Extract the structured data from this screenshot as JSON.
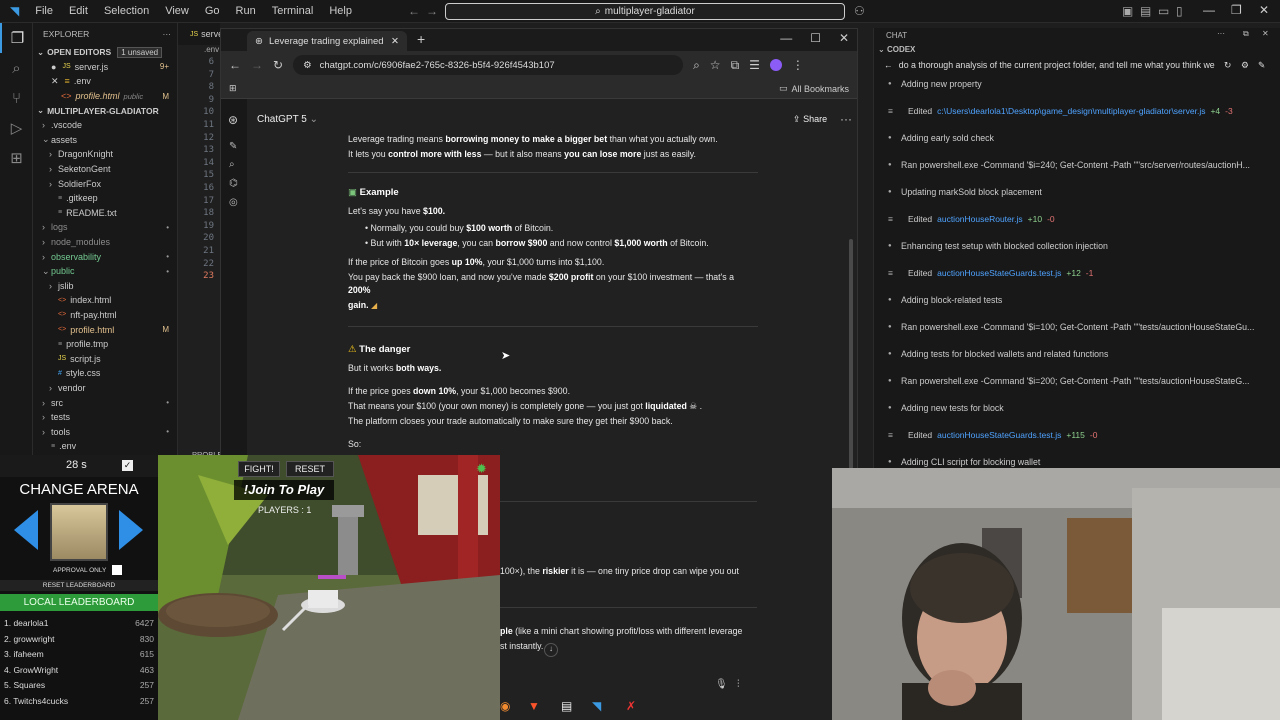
{
  "vscode": {
    "menu": [
      "File",
      "Edit",
      "Selection",
      "View",
      "Go",
      "Run",
      "Terminal",
      "Help"
    ],
    "command_center": "multiplayer-gladiator",
    "explorer_title": "EXPLORER",
    "open_editors_title": "OPEN EDITORS",
    "unsaved_badge": "1 unsaved",
    "open_editors": [
      {
        "name": "server.js",
        "badge": "9+"
      },
      {
        "name": ".env",
        "badge": ""
      },
      {
        "name": "profile.html",
        "desc": "public",
        "badge": "M"
      }
    ],
    "project_title": "MULTIPLAYER-GLADIATOR",
    "tree": [
      {
        "name": ".vscode",
        "indent": 1,
        "type": "folder"
      },
      {
        "name": "assets",
        "indent": 1,
        "type": "folder-open"
      },
      {
        "name": "DragonKnight",
        "indent": 2,
        "type": "folder"
      },
      {
        "name": "SeketonGent",
        "indent": 2,
        "type": "folder"
      },
      {
        "name": "SoldierFox",
        "indent": 2,
        "type": "folder"
      },
      {
        "name": ".gitkeep",
        "indent": 2,
        "type": "file"
      },
      {
        "name": "README.txt",
        "indent": 2,
        "type": "file"
      },
      {
        "name": "logs",
        "indent": 1,
        "type": "folder",
        "mark": "•"
      },
      {
        "name": "node_modules",
        "indent": 1,
        "type": "folder"
      },
      {
        "name": "observability",
        "indent": 1,
        "type": "folder",
        "mark": "•"
      },
      {
        "name": "public",
        "indent": 1,
        "type": "folder-open",
        "mark": "•"
      },
      {
        "name": "jslib",
        "indent": 2,
        "type": "folder"
      },
      {
        "name": "index.html",
        "indent": 2,
        "type": "file"
      },
      {
        "name": "nft-pay.html",
        "indent": 2,
        "type": "file"
      },
      {
        "name": "profile.html",
        "indent": 2,
        "type": "file",
        "mark": "M"
      },
      {
        "name": "profile.tmp",
        "indent": 2,
        "type": "file"
      },
      {
        "name": "script.js",
        "indent": 2,
        "type": "file"
      },
      {
        "name": "style.css",
        "indent": 2,
        "type": "file"
      },
      {
        "name": "vendor",
        "indent": 2,
        "type": "folder"
      },
      {
        "name": "src",
        "indent": 1,
        "type": "folder",
        "mark": "•"
      },
      {
        "name": "tests",
        "indent": 1,
        "type": "folder"
      },
      {
        "name": "tools",
        "indent": 1,
        "type": "folder",
        "mark": "•"
      },
      {
        "name": ".env",
        "indent": 1,
        "type": "file"
      }
    ],
    "line_numbers": [
      "6",
      "7",
      "8",
      "9",
      "10",
      "11",
      "12",
      "13",
      "14",
      "15",
      "16",
      "17",
      "18",
      "19",
      "20",
      "21",
      "22",
      "23"
    ],
    "editor_tab_fragment": "serve",
    "editor_tab_fragment2": ".env",
    "problems_fragment": "PROBLE"
  },
  "browser": {
    "tab_title": "Leverage trading explained",
    "url": "chatgpt.com/c/6906fae2-765c-8326-b5f4-926f4543b107",
    "bookmarks_label": "All Bookmarks",
    "model_label": "ChatGPT 5",
    "share_label": "Share"
  },
  "chat": {
    "intro_line1_a": "Leverage trading means ",
    "intro_line1_b": "borrowing money to make a bigger bet",
    "intro_line1_c": " than what you actually own.",
    "intro_line2_a": "It lets you ",
    "intro_line2_b": "control more with less",
    "intro_line2_c": " — but it also means ",
    "intro_line2_d": "you can lose more",
    "intro_line2_e": " just as easily.",
    "example_heading": "Example",
    "example_intro_a": "Let's say you have ",
    "example_intro_b": "$100.",
    "bullet1_a": "Normally, you could buy ",
    "bullet1_b": "$100 worth",
    "bullet1_c": " of Bitcoin.",
    "bullet2_a": "But with ",
    "bullet2_b": "10× leverage",
    "bullet2_c": ", you can ",
    "bullet2_d": "borrow $900",
    "bullet2_e": " and now control ",
    "bullet2_f": "$1,000 worth",
    "bullet2_g": " of Bitcoin.",
    "up_a": "If the price of Bitcoin goes ",
    "up_b": "up 10%",
    "up_c": ", your $1,000 turns into $1,100.",
    "payback_a": "You pay back the $900 loan, and now you've made ",
    "payback_b": "$200 profit",
    "payback_c": " on your $100 investment — that's a ",
    "payback_d": "200%",
    "payback_e": "gain.",
    "danger_heading": "The danger",
    "both_a": "But it works ",
    "both_b": "both ways.",
    "down_a": "If the price goes ",
    "down_b": "down 10%",
    "down_c": ", your $1,000 becomes $900.",
    "gone_a": "That means your $100 (your own money) is completely gone — you just got ",
    "gone_b": "liquidated",
    "closes": "The platform closes your trade automatically to make sure they get their $900 back.",
    "so": "So:",
    "riskier_a": "100×), the ",
    "riskier_b": "riskier",
    "riskier_c": " it is — one tiny price drop can wipe you out",
    "mini_a": "ple",
    "mini_b": " (like a mini chart showing profit/loss with different leverage",
    "instantly": "st instantly."
  },
  "codex": {
    "chat_label": "CHAT",
    "codex_label": "CODEX",
    "prompt": "do a thorough analysis of the current project folder, and tell me what you think we",
    "items": [
      {
        "kind": "item",
        "text": "Adding new property"
      },
      {
        "kind": "edit",
        "label": "Edited",
        "file": "c:\\Users\\dearlola1\\Desktop\\game_design\\multiplayer-gladiator\\server.js",
        "plus": "+4",
        "minus": "-3"
      },
      {
        "kind": "item",
        "text": "Adding early sold check"
      },
      {
        "kind": "item",
        "text": "Ran powershell.exe -Command '$i=240; Get-Content -Path \"\"src/server/routes/auctionH..."
      },
      {
        "kind": "item",
        "text": "Updating markSold block placement"
      },
      {
        "kind": "edit",
        "label": "Edited",
        "file": "auctionHouseRouter.js",
        "plus": "+10",
        "minus": "-0"
      },
      {
        "kind": "item",
        "text": "Enhancing test setup with blocked collection injection"
      },
      {
        "kind": "edit",
        "label": "Edited",
        "file": "auctionHouseStateGuards.test.js",
        "plus": "+12",
        "minus": "-1"
      },
      {
        "kind": "item",
        "text": "Adding block-related tests"
      },
      {
        "kind": "item",
        "text": "Ran powershell.exe -Command '$i=100; Get-Content -Path \"\"tests/auctionHouseStateGu..."
      },
      {
        "kind": "item",
        "text": "Adding tests for blocked wallets and related functions"
      },
      {
        "kind": "item",
        "text": "Ran powershell.exe -Command '$i=200; Get-Content -Path \"\"tests/auctionHouseStateG..."
      },
      {
        "kind": "item",
        "text": "Adding new tests for block"
      },
      {
        "kind": "edit",
        "label": "Edited",
        "file": "auctionHouseStateGuards.test.js",
        "plus": "+115",
        "minus": "-0"
      },
      {
        "kind": "item",
        "text": "Adding CLI script for blocking wallet"
      }
    ]
  },
  "game": {
    "timer": "28 s",
    "change_arena": "CHANGE ARENA",
    "approval_only": "APPROVAL ONLY",
    "reset_leaderboard": "RESET LEADERBOARD",
    "local_leaderboard": "LOCAL LEADERBOARD",
    "fight": "FIGHT!",
    "reset": "RESET",
    "join": "!Join To Play",
    "players": "PLAYERS : 1",
    "leaderboard": [
      {
        "name": "1. dearlola1",
        "score": "6427"
      },
      {
        "name": "2. growwright",
        "score": "830"
      },
      {
        "name": "3. ifaheem",
        "score": "615"
      },
      {
        "name": "4. GrowWright",
        "score": "463"
      },
      {
        "name": "5. Squares",
        "score": "257"
      },
      {
        "name": "6. Twitchs4cucks",
        "score": "257"
      }
    ]
  }
}
